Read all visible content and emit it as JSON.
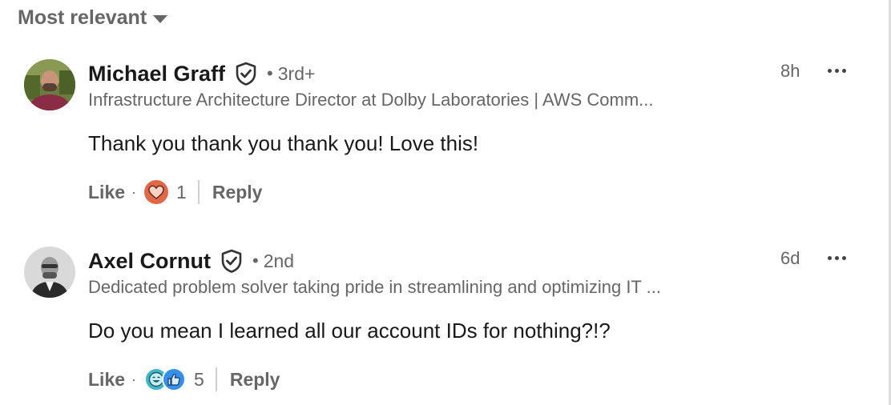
{
  "sort": {
    "label": "Most relevant"
  },
  "comments": [
    {
      "name": "Michael Graff",
      "degree": "3rd+",
      "headline": "Infrastructure Architecture Director at Dolby Laboratories | AWS Comm...",
      "time": "8h",
      "text": "Thank you thank you thank you! Love this!",
      "like_label": "Like",
      "reaction_count": "1",
      "reply_label": "Reply",
      "reactions": [
        "love-icon"
      ]
    },
    {
      "name": "Axel Cornut",
      "degree": "2nd",
      "headline": "Dedicated problem solver taking pride in streamlining and optimizing IT ...",
      "time": "6d",
      "text": "Do you mean I learned all our account IDs for nothing?!?",
      "like_label": "Like",
      "reaction_count": "5",
      "reply_label": "Reply",
      "reactions": [
        "funny-icon",
        "like-icon"
      ]
    }
  ],
  "separators": {
    "dot": "•",
    "small_dot": "·"
  },
  "colors": {
    "love": "#e06847",
    "like": "#378fe9",
    "funny": "#44b5c9",
    "muted": "#666666"
  }
}
